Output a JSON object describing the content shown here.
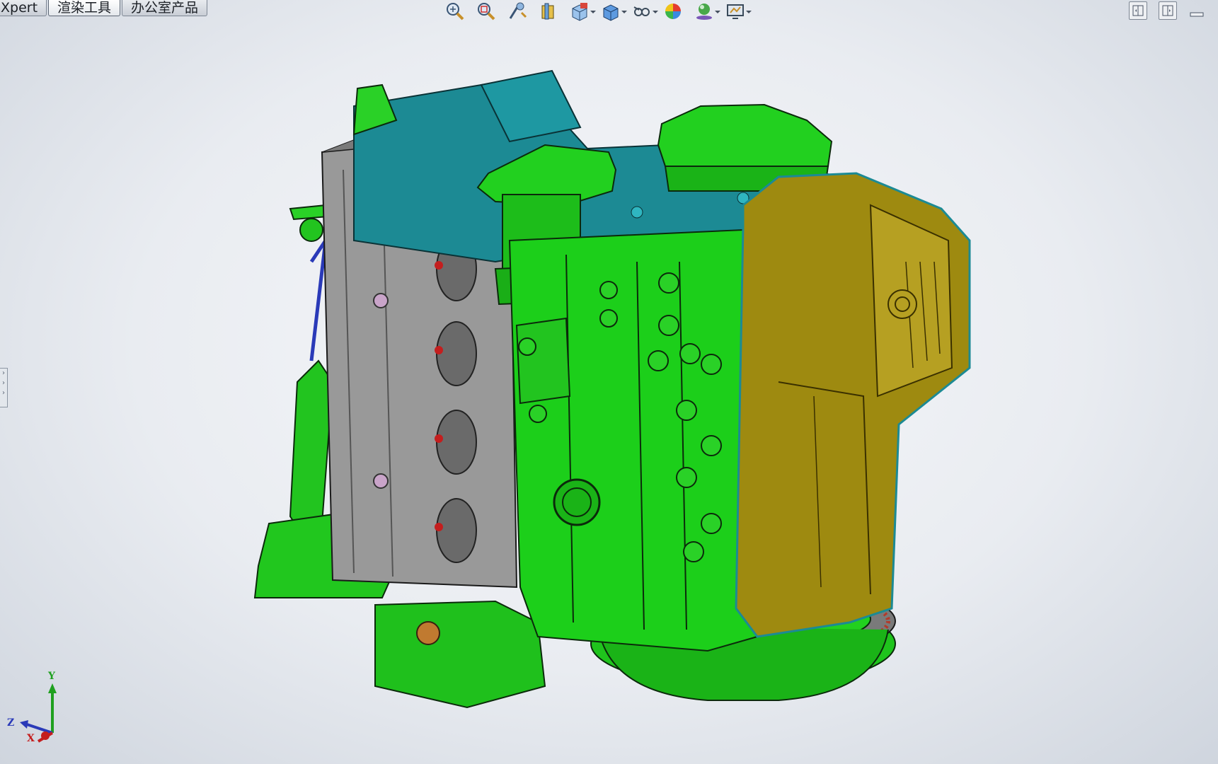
{
  "tabs": [
    {
      "label": "Xpert"
    },
    {
      "label": "渲染工具"
    },
    {
      "label": "办公室产品"
    }
  ],
  "heads_up_toolbar": [
    {
      "icon": "zoom-to-fit-icon"
    },
    {
      "icon": "zoom-to-area-icon"
    },
    {
      "icon": "previous-view-icon"
    },
    {
      "icon": "section-view-icon"
    },
    {
      "icon": "view-orientation-icon"
    },
    {
      "icon": "display-style-icon"
    },
    {
      "icon": "hide-show-items-icon"
    },
    {
      "icon": "edit-appearance-icon"
    },
    {
      "icon": "apply-scene-icon"
    },
    {
      "icon": "view-settings-icon"
    }
  ],
  "window_controls": [
    {
      "icon": "tile-horizontal-icon"
    },
    {
      "icon": "tile-vertical-icon"
    },
    {
      "icon": "minimize-icon"
    }
  ],
  "triad": {
    "x": "X",
    "y": "Y",
    "z": "Z"
  },
  "colors": {
    "head_green": "#17c417",
    "block_green": "#1ccf1a",
    "cover_teal": "#1c8a94",
    "oil_pan_olive": "#9e8a10",
    "head_gray": "#9a9a9a",
    "edge": "#0b2a0b"
  }
}
